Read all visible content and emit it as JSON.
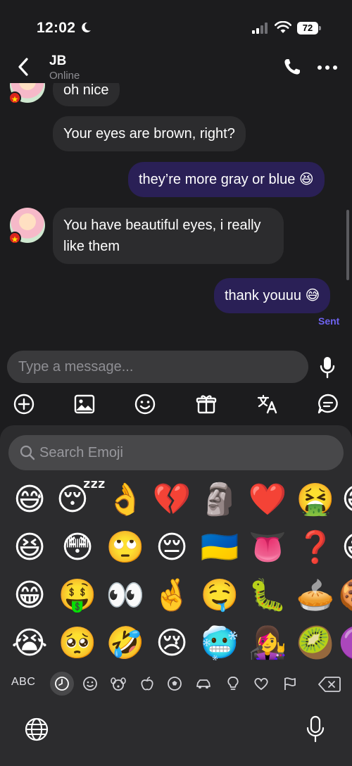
{
  "status_bar": {
    "time": "12:02",
    "battery": "72"
  },
  "header": {
    "name": "JB",
    "status": "Online"
  },
  "messages": [
    {
      "dir": "in",
      "text": "oh nice"
    },
    {
      "dir": "in",
      "text": "Your eyes are brown, right?"
    },
    {
      "dir": "out",
      "text": "they’re more gray or blue 😆"
    },
    {
      "dir": "in",
      "text": "You have beautiful eyes, i really like them"
    },
    {
      "dir": "out",
      "text": "thank youuu 😅"
    }
  ],
  "sent_label": "Sent",
  "composer": {
    "placeholder": "Type a message..."
  },
  "toolbar_icons": [
    "add-icon",
    "image-icon",
    "emoji-icon",
    "gift-icon",
    "translate-icon",
    "quick-reply-icon"
  ],
  "emoji_keyboard": {
    "search_placeholder": "Search Emoji",
    "rows": [
      [
        "😅",
        "😴",
        "👌",
        "💔",
        "🗿",
        "❤️",
        "🤮",
        "😅"
      ],
      [
        "😆",
        "😳",
        "🙄",
        "😔",
        "🇺🇦",
        "👅",
        "❓",
        "😀"
      ],
      [
        "😁",
        "🤑",
        "👀",
        "🤞",
        "🤤",
        "🐛",
        "🥧",
        "🍪"
      ],
      [
        "😭",
        "🥺",
        "🤣",
        "😢",
        "🥶",
        "👩‍🎤",
        "🥝",
        "🟣"
      ]
    ],
    "abc_label": "ABC",
    "categories": [
      "recent-icon",
      "smiley-icon",
      "animal-icon",
      "food-icon",
      "activity-icon",
      "travel-icon",
      "objects-icon",
      "symbols-icon",
      "flags-icon"
    ],
    "active_category": "recent-icon"
  },
  "colors": {
    "outgoing_bubble": "#2a2056",
    "incoming_bubble": "#2c2c2e",
    "accent": "#6e63f0"
  }
}
